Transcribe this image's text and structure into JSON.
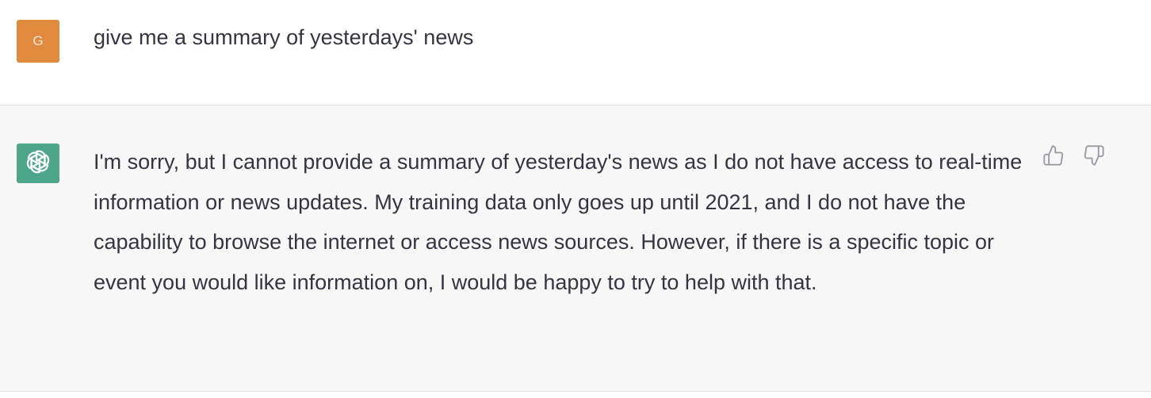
{
  "user_message": {
    "avatar_initial": "G",
    "avatar_color": "#df8a3c",
    "text": "give me a summary of yesterdays' news"
  },
  "assistant_message": {
    "avatar_icon": "openai-logo-icon",
    "avatar_color": "#4da58a",
    "text": "I'm sorry, but I cannot provide a summary of yesterday's news as I do not have access to real-time information or news updates. My training data only goes up until 2021, and I do not have the capability to browse the internet or access news sources. However, if there is a specific topic or event you would like information on, I would be happy to try to help with that.",
    "actions": {
      "like_icon": "thumbs-up-icon",
      "dislike_icon": "thumbs-down-icon"
    }
  }
}
